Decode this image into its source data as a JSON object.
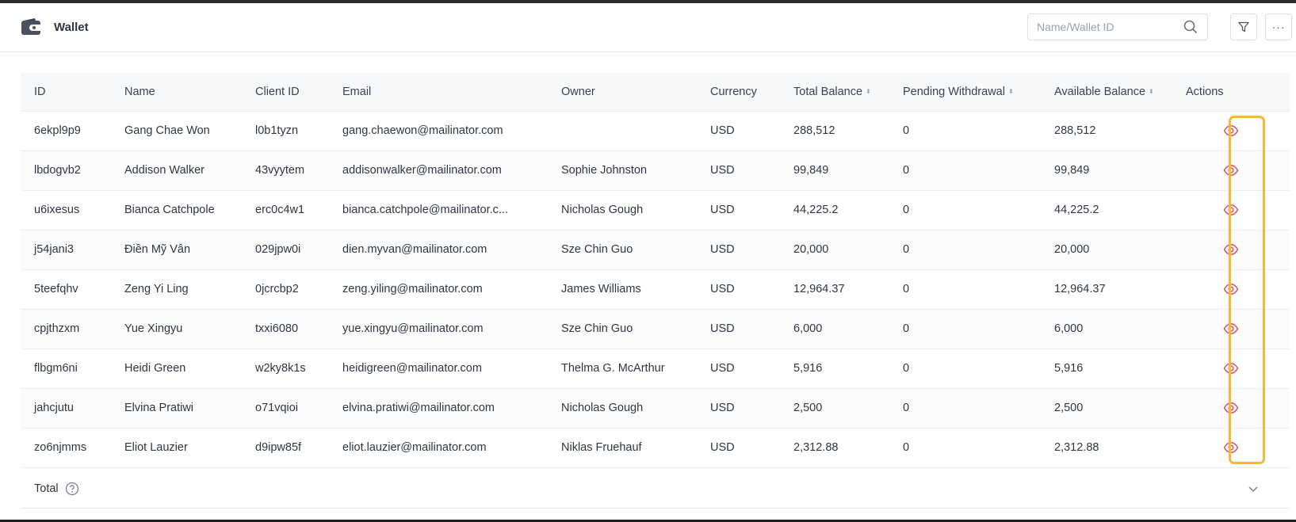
{
  "header": {
    "title": "Wallet",
    "search_placeholder": "Name/Wallet ID",
    "more_label": "···"
  },
  "table": {
    "columns": [
      "ID",
      "Name",
      "Client ID",
      "Email",
      "Owner",
      "Currency",
      "Total Balance",
      "Pending Withdrawal",
      "Available Balance",
      "Actions"
    ],
    "rows": [
      {
        "id": "6ekpl9p9",
        "name": "Gang Chae Won",
        "client_id": "l0b1tyzn",
        "email": "gang.chaewon@mailinator.com",
        "owner": "",
        "currency": "USD",
        "total": "288,512",
        "pending": "0",
        "available": "288,512"
      },
      {
        "id": "lbdogvb2",
        "name": "Addison Walker",
        "client_id": "43vyytem",
        "email": "addisonwalker@mailinator.com",
        "owner": "Sophie Johnston",
        "currency": "USD",
        "total": "99,849",
        "pending": "0",
        "available": "99,849"
      },
      {
        "id": "u6ixesus",
        "name": "Bianca Catchpole",
        "client_id": "erc0c4w1",
        "email": "bianca.catchpole@mailinator.c...",
        "owner": "Nicholas Gough",
        "currency": "USD",
        "total": "44,225.2",
        "pending": "0",
        "available": "44,225.2"
      },
      {
        "id": "j54jani3",
        "name": "Điền Mỹ Vân",
        "client_id": "029jpw0i",
        "email": "dien.myvan@mailinator.com",
        "owner": "Sze Chin Guo",
        "currency": "USD",
        "total": "20,000",
        "pending": "0",
        "available": "20,000"
      },
      {
        "id": "5teefqhv",
        "name": "Zeng Yi Ling",
        "client_id": "0jcrcbp2",
        "email": "zeng.yiling@mailinator.com",
        "owner": "James Williams",
        "currency": "USD",
        "total": "12,964.37",
        "pending": "0",
        "available": "12,964.37"
      },
      {
        "id": "cpjthzxm",
        "name": "Yue Xingyu",
        "client_id": "txxi6080",
        "email": "yue.xingyu@mailinator.com",
        "owner": "Sze Chin Guo",
        "currency": "USD",
        "total": "6,000",
        "pending": "0",
        "available": "6,000"
      },
      {
        "id": "flbgm6ni",
        "name": "Heidi Green",
        "client_id": "w2ky8k1s",
        "email": "heidigreen@mailinator.com",
        "owner": "Thelma G. McArthur",
        "currency": "USD",
        "total": "5,916",
        "pending": "0",
        "available": "5,916"
      },
      {
        "id": "jahcjutu",
        "name": "Elvina Pratiwi",
        "client_id": "o71vqioi",
        "email": "elvina.pratiwi@mailinator.com",
        "owner": "Nicholas Gough",
        "currency": "USD",
        "total": "2,500",
        "pending": "0",
        "available": "2,500"
      },
      {
        "id": "zo6njmms",
        "name": "Eliot Lauzier",
        "client_id": "d9ipw85f",
        "email": "eliot.lauzier@mailinator.com",
        "owner": "Niklas Fruehauf",
        "currency": "USD",
        "total": "2,312.88",
        "pending": "0",
        "available": "2,312.88"
      }
    ]
  },
  "footer": {
    "total_label": "Total"
  },
  "colors": {
    "action_icon": "#d94f5c",
    "highlight": "#f5b93a",
    "header_bg": "#f7f8fa"
  },
  "icons": {
    "header": "wallet-icon",
    "search": "search-icon",
    "filter": "filter-icon",
    "more": "more-icon",
    "row_action": "eye-icon",
    "help": "help-icon",
    "expand": "chevron-down-icon"
  }
}
